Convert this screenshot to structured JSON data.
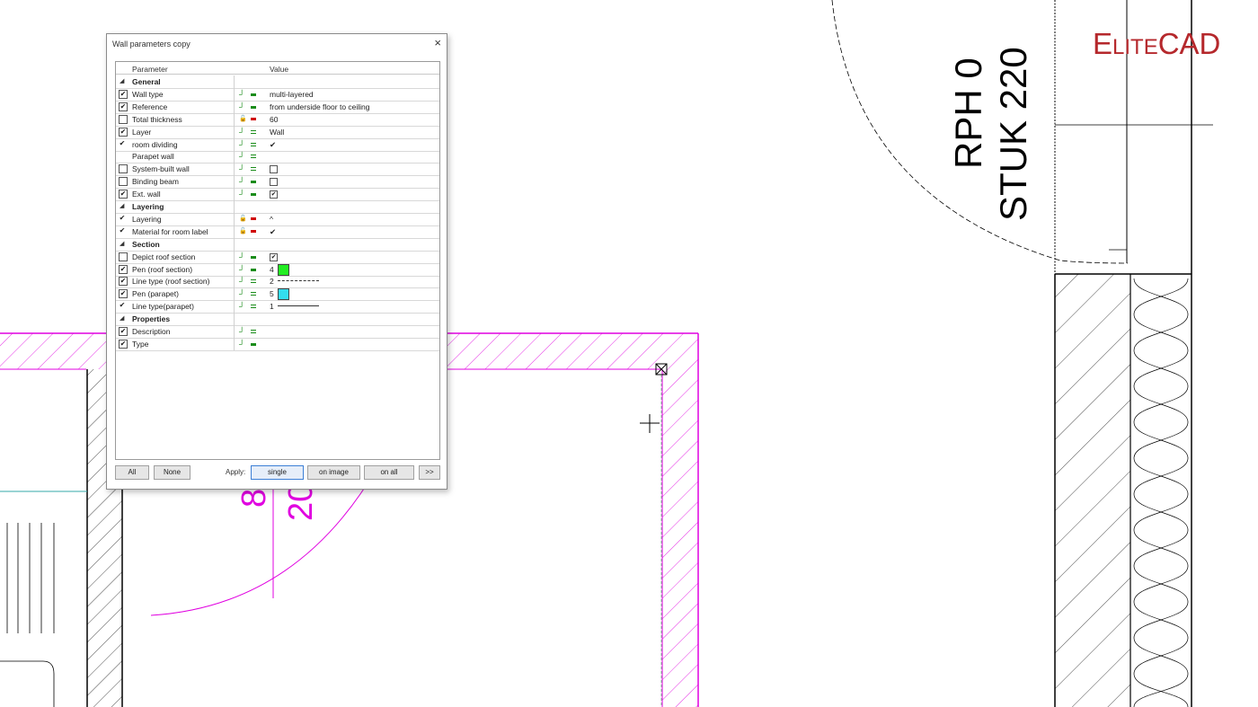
{
  "brand": {
    "text_prefix": "E",
    "text_small": "LITE",
    "text_suffix": "CAD",
    "color": "#b5282c"
  },
  "drawing": {
    "label_line1": "RPH 0",
    "label_line2": "STUK 220",
    "dim_a": "8",
    "dim_b": "20",
    "wall_color": "#e000e0",
    "line_color": "#000000"
  },
  "dialog": {
    "title": "Wall parameters copy",
    "close_glyph": "×",
    "columns": {
      "parameter": "Parameter",
      "value": "Value"
    },
    "rows": [
      {
        "kind": "section",
        "label": "General"
      },
      {
        "kind": "param",
        "check": "box-checked",
        "label": "Wall type",
        "lock": "green",
        "value": "multi-layered"
      },
      {
        "kind": "param",
        "check": "box-checked",
        "label": "Reference",
        "lock": "green",
        "value": "from underside floor to ceiling"
      },
      {
        "kind": "param",
        "check": "box",
        "label": "Total thickness",
        "lock": "red",
        "value": "60"
      },
      {
        "kind": "param",
        "check": "box-checked",
        "label": "Layer",
        "lock": "green-open",
        "value": "Wall"
      },
      {
        "kind": "param",
        "check": "tick",
        "label": "room dividing",
        "lock": "green-open",
        "value": "✔"
      },
      {
        "kind": "param",
        "check": "none",
        "label": "Parapet wall",
        "lock": "green-open",
        "value": ""
      },
      {
        "kind": "param",
        "check": "box",
        "label": "System-built wall",
        "lock": "green-open",
        "value": "",
        "vbox": "empty"
      },
      {
        "kind": "param",
        "check": "box",
        "label": "Binding beam",
        "lock": "green",
        "value": "",
        "vbox": "empty"
      },
      {
        "kind": "param",
        "check": "box-checked",
        "label": "Ext. wall",
        "lock": "green",
        "value": "",
        "vbox": "checked"
      },
      {
        "kind": "section",
        "label": "Layering"
      },
      {
        "kind": "param",
        "check": "tick",
        "label": "Layering",
        "lock": "red",
        "value": "^"
      },
      {
        "kind": "param",
        "check": "tick",
        "label": "Material for room label",
        "lock": "red",
        "value": "✔"
      },
      {
        "kind": "section",
        "label": "Section"
      },
      {
        "kind": "param",
        "check": "box",
        "label": "Depict roof section",
        "lock": "green",
        "value": "",
        "vbox": "checked"
      },
      {
        "kind": "param",
        "check": "box-checked",
        "label": "Pen (roof section)",
        "lock": "green",
        "value": "4",
        "swatch": "#22ee22"
      },
      {
        "kind": "param",
        "check": "box-checked",
        "label": "Line type (roof section)",
        "lock": "green-open",
        "value": "2",
        "ltype": "dashed"
      },
      {
        "kind": "param",
        "check": "box-checked",
        "label": "Pen (parapet)",
        "lock": "green-open",
        "value": "5",
        "swatch": "#33ddee"
      },
      {
        "kind": "param",
        "check": "tick",
        "label": "Line type(parapet)",
        "lock": "green-open",
        "value": "1",
        "ltype": "solid"
      },
      {
        "kind": "section",
        "label": "Properties"
      },
      {
        "kind": "param",
        "check": "box-checked",
        "label": "Description",
        "lock": "green-open",
        "value": ""
      },
      {
        "kind": "param",
        "check": "box-checked",
        "label": "Type",
        "lock": "green",
        "value": ""
      }
    ],
    "buttons": {
      "all": "All",
      "none": "None",
      "apply_label": "Apply:",
      "single": "single",
      "on_image": "on image",
      "on_all": "on all",
      "more": ">>"
    }
  }
}
